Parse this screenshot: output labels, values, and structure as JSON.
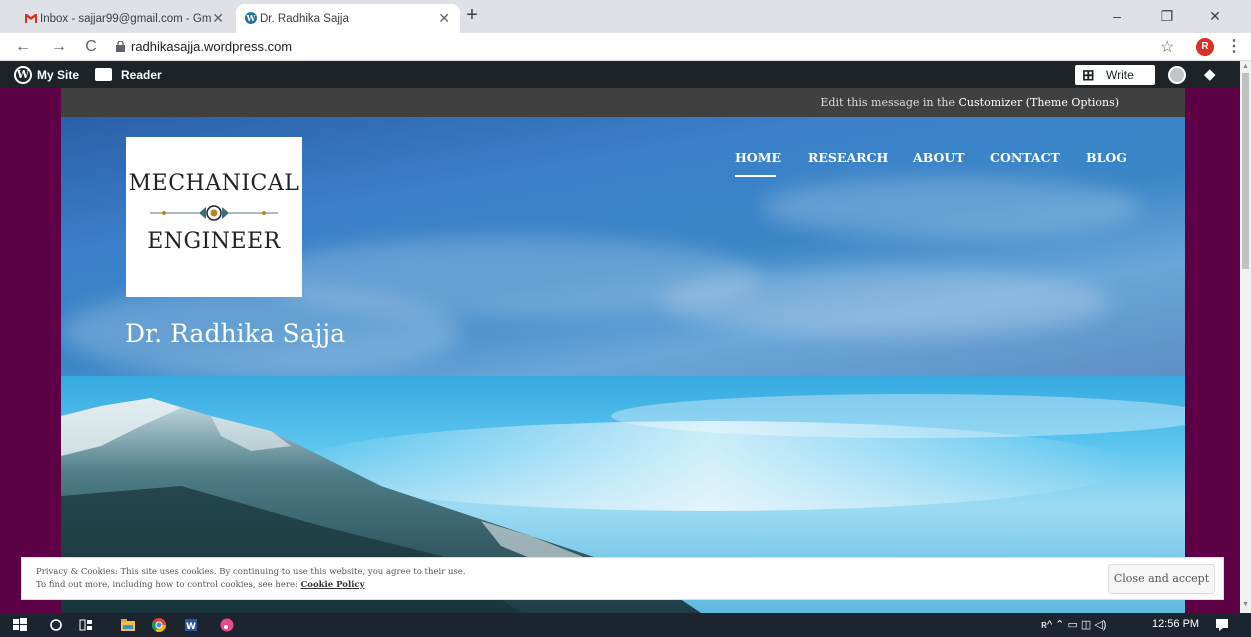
{
  "browser": {
    "tabs": [
      {
        "label": "Inbox - sajjar99@gmail.com - Gm",
        "favicon": "gmail-icon"
      },
      {
        "label": "Dr. Radhika Sajja",
        "favicon": "wordpress-icon"
      }
    ],
    "new_tab": "+",
    "url": "radhikasajja.wordpress.com",
    "profile_initial": "R",
    "window_controls": {
      "minimize": "–",
      "restore": "❐",
      "close": "✕"
    },
    "nav": {
      "back": "←",
      "forward": "→",
      "reload": "C"
    },
    "bookmark": "☆",
    "menu": "⋮"
  },
  "wpbar": {
    "my_site": "My Site",
    "reader": "Reader",
    "write": "Write"
  },
  "site": {
    "message_prefix": "Edit this message in the ",
    "message_link": "Customizer (Theme Options)",
    "logo_line1": "MECHANICAL",
    "logo_line2": "ENGINEER",
    "title": "Dr. Radhika Sajja",
    "nav": [
      "HOME",
      "RESEARCH",
      "ABOUT",
      "CONTACT",
      "BLOG"
    ],
    "colors": {
      "background": "#5e0045",
      "message_bar": "#404040"
    }
  },
  "cookie": {
    "line1": "Privacy & Cookies: This site uses cookies. By continuing to use this website, you agree to their use.",
    "line2_prefix": "To find out more, including how to control cookies, see here: ",
    "link": "Cookie Policy",
    "button": "Close and accept"
  },
  "taskbar": {
    "clock": "12:56 PM",
    "tray": "ʀ^  ⌃  ▭  ◫  ◁)"
  }
}
